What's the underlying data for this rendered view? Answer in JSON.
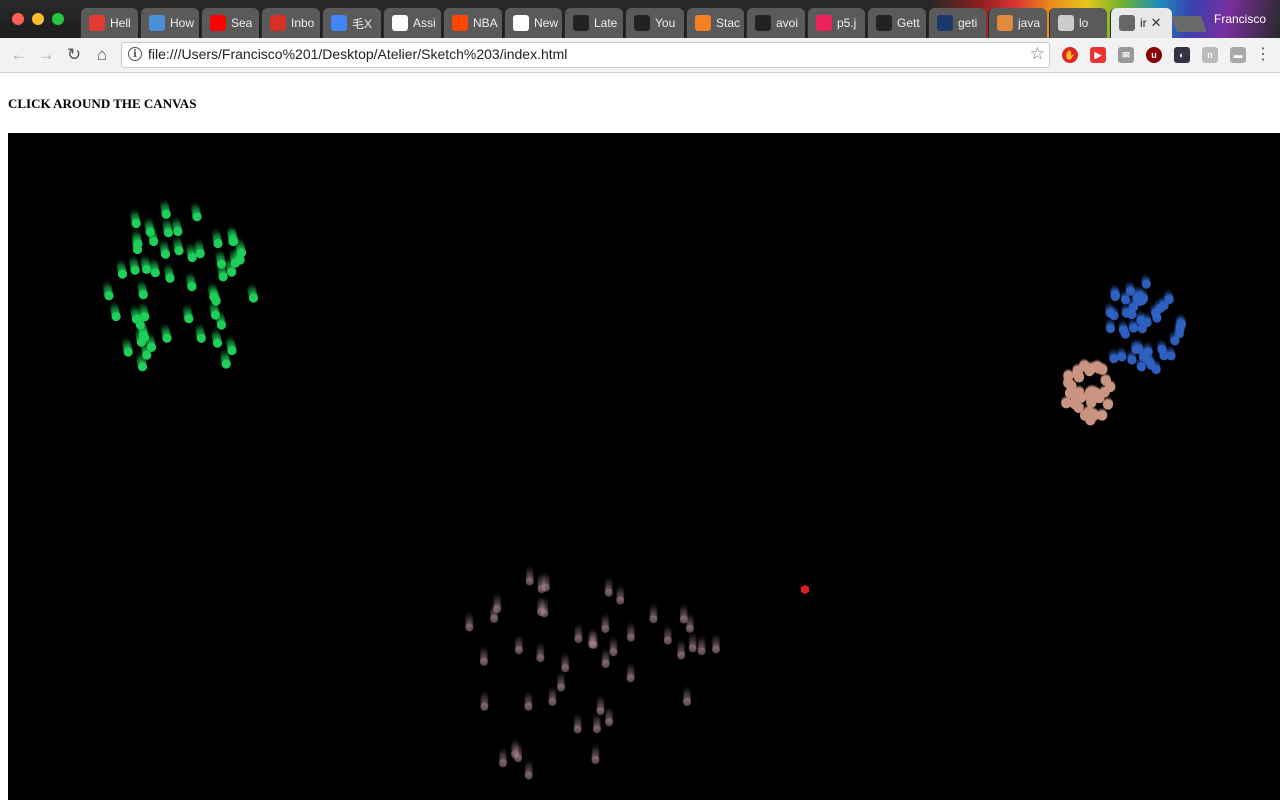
{
  "browser": {
    "tabs": [
      {
        "label": "Hell",
        "icon": "opera-icon",
        "color": "#e03c31"
      },
      {
        "label": "How",
        "icon": "globe-icon",
        "color": "#4a90d9"
      },
      {
        "label": "Sea",
        "icon": "youtube-icon",
        "color": "#ff0000"
      },
      {
        "label": "Inbo",
        "icon": "gmail-icon",
        "color": "#d93025"
      },
      {
        "label": "毛X",
        "icon": "google-icon",
        "color": "#4285f4"
      },
      {
        "label": "Assi",
        "icon": "grid-icon",
        "color": "#ffffff"
      },
      {
        "label": "NBA",
        "icon": "reddit-icon",
        "color": "#ff4500"
      },
      {
        "label": "New",
        "icon": "circle-icon",
        "color": "#ffffff"
      },
      {
        "label": "Late",
        "icon": "quora-icon",
        "color": "#222222"
      },
      {
        "label": "You",
        "icon": "github-icon",
        "color": "#222222"
      },
      {
        "label": "Stac",
        "icon": "stackoverflow-icon",
        "color": "#f48024"
      },
      {
        "label": "avoi",
        "icon": "github-icon",
        "color": "#222222"
      },
      {
        "label": "p5.j",
        "icon": "star-icon",
        "color": "#ed225d"
      },
      {
        "label": "Gett",
        "icon": "github-icon",
        "color": "#222222"
      },
      {
        "label": "geti",
        "icon": "p-icon",
        "color": "#1a3a6b"
      },
      {
        "label": "java",
        "icon": "pencil-icon",
        "color": "#e08a3a"
      },
      {
        "label": "lo",
        "icon": "file-icon",
        "color": "#cccccc"
      },
      {
        "label": "ir",
        "icon": "file-icon",
        "color": "#666666",
        "active": true
      }
    ],
    "profile_name": "Francisco",
    "url": "file:///Users/Francisco%201/Desktop/Atelier/Sketch%203/index.html"
  },
  "page": {
    "heading": "CLICK AROUND THE CANVAS"
  },
  "canvas": {
    "background": "#000000",
    "fireworks": [
      {
        "name": "green-firework",
        "color": "#1ecf5a",
        "brightness": 1.0
      },
      {
        "name": "blue-firework",
        "color": "#2f62c4",
        "brightness": 0.95
      },
      {
        "name": "peach-firework",
        "color": "#c99482",
        "brightness": 1.0
      },
      {
        "name": "mauve-firework",
        "color": "#a88590",
        "brightness": 0.55
      }
    ],
    "cursor_color": "#e21b2c"
  }
}
